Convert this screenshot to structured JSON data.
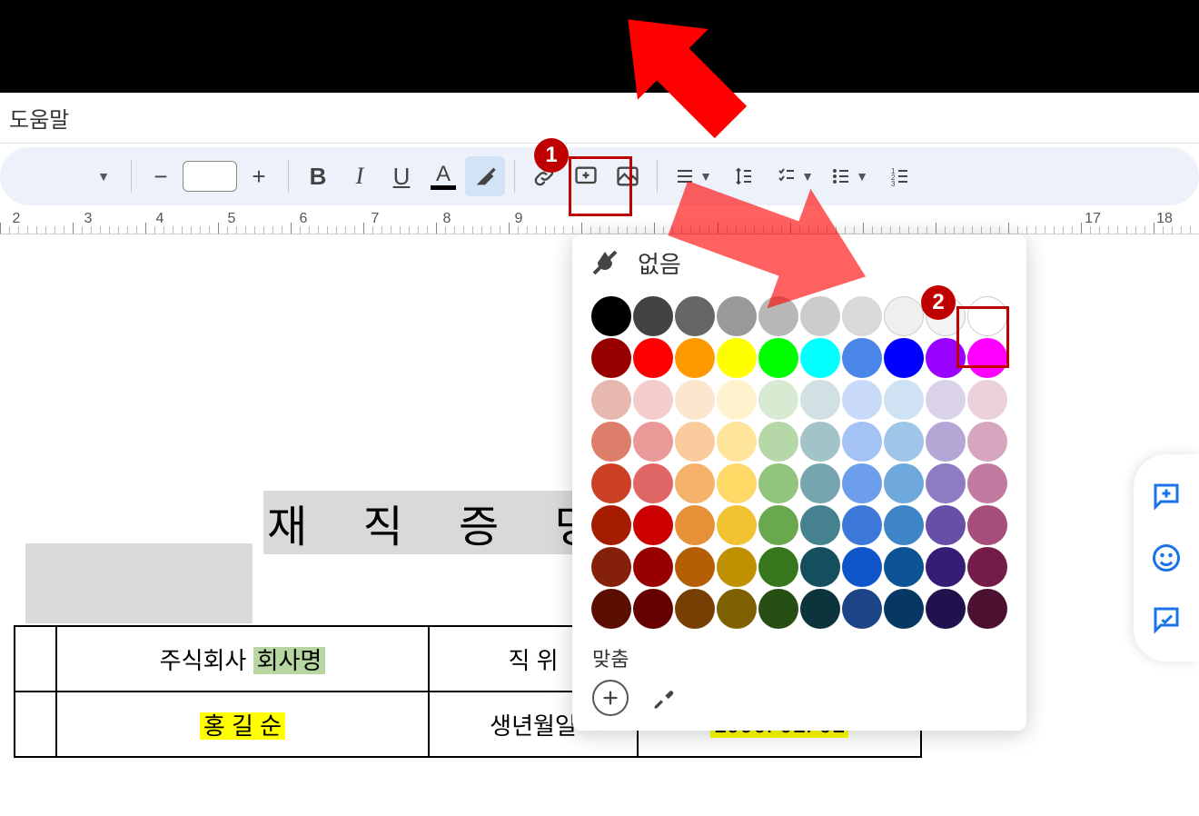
{
  "menu": {
    "help": "도움말"
  },
  "ruler": {
    "numbers": [
      2,
      3,
      4,
      5,
      6,
      7,
      8,
      9,
      17,
      18
    ]
  },
  "document": {
    "title": "재 직 증 명 서",
    "table": {
      "row1": {
        "cell1_prefix": "주식회사 ",
        "cell1_highlight": "회사명",
        "cell2_label": "직 위"
      },
      "row2": {
        "cell1_highlight": "홍 길 순",
        "cell2_label": "생년월일",
        "cell3_highlight": "1990. 01. 01"
      }
    }
  },
  "color_popup": {
    "none_label": "없음",
    "custom_label": "맞춤",
    "rows": [
      [
        "#000000",
        "#434343",
        "#666666",
        "#999999",
        "#b7b7b7",
        "#cccccc",
        "#d9d9d9",
        "#efefef",
        "#f3f3f3",
        "#ffffff"
      ],
      [
        "#980000",
        "#ff0000",
        "#ff9900",
        "#ffff00",
        "#00ff00",
        "#00ffff",
        "#4a86e8",
        "#0000ff",
        "#9900ff",
        "#ff00ff"
      ],
      [
        "#e6b8af",
        "#f4cccc",
        "#fce5cd",
        "#fff2cc",
        "#d9ead3",
        "#d0e0e3",
        "#c9daf8",
        "#cfe2f3",
        "#d9d2e9",
        "#ead1dc"
      ],
      [
        "#dd7e6b",
        "#ea9999",
        "#f9cb9c",
        "#ffe599",
        "#b6d7a8",
        "#a2c4c9",
        "#a4c2f4",
        "#9fc5e8",
        "#b4a7d6",
        "#d5a6bd"
      ],
      [
        "#cc4125",
        "#e06666",
        "#f6b26b",
        "#ffd966",
        "#93c47d",
        "#76a5af",
        "#6d9eeb",
        "#6fa8dc",
        "#8e7cc3",
        "#c27ba0"
      ],
      [
        "#a61c00",
        "#cc0000",
        "#e69138",
        "#f1c232",
        "#6aa84f",
        "#45818e",
        "#3c78d8",
        "#3d85c6",
        "#674ea7",
        "#a64d79"
      ],
      [
        "#85200c",
        "#990000",
        "#b45f06",
        "#bf9000",
        "#38761d",
        "#134f5c",
        "#1155cc",
        "#0b5394",
        "#351c75",
        "#741b47"
      ],
      [
        "#5b0f00",
        "#660000",
        "#783f04",
        "#7f6000",
        "#274e13",
        "#0c343d",
        "#1c4587",
        "#073763",
        "#20124d",
        "#4c1130"
      ]
    ]
  },
  "annotations": {
    "badge1": "1",
    "badge2": "2"
  }
}
